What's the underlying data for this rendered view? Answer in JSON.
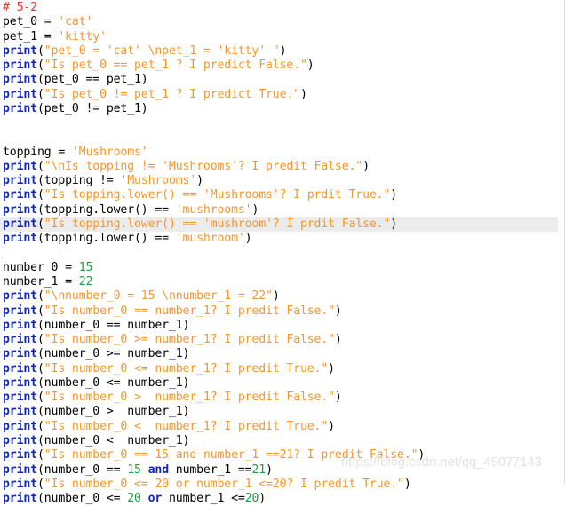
{
  "editor": {
    "language": "python",
    "background_color": "#ffffff",
    "right_border_color": "#cfe8cf",
    "current_line_highlight_color": "#ececec",
    "current_line_index": 15,
    "colors": {
      "plain": "#000000",
      "comment": "#e8372c",
      "string": "#f5972b",
      "keyword": "#1126b5",
      "number": "#1b9d3e"
    }
  },
  "watermark": {
    "text": "https://blog.csdn.net/qq_45077143"
  },
  "lines": [
    {
      "n": 1,
      "tokens": [
        {
          "t": "# 5-2",
          "c": "comment"
        }
      ]
    },
    {
      "n": 2,
      "tokens": [
        {
          "t": "pet_0 = ",
          "c": "plain"
        },
        {
          "t": "'cat'",
          "c": "string"
        }
      ]
    },
    {
      "n": 3,
      "tokens": [
        {
          "t": "pet_1 = ",
          "c": "plain"
        },
        {
          "t": "'kitty'",
          "c": "string"
        }
      ]
    },
    {
      "n": 4,
      "tokens": [
        {
          "t": "print",
          "c": "keyword"
        },
        {
          "t": "(",
          "c": "plain"
        },
        {
          "t": "\"pet_0 = 'cat' \\npet_1 = 'kitty' \"",
          "c": "string"
        },
        {
          "t": ")",
          "c": "plain"
        }
      ]
    },
    {
      "n": 5,
      "tokens": [
        {
          "t": "print",
          "c": "keyword"
        },
        {
          "t": "(",
          "c": "plain"
        },
        {
          "t": "\"Is pet_0 == pet_1 ? I predict False.\"",
          "c": "string"
        },
        {
          "t": ")",
          "c": "plain"
        }
      ]
    },
    {
      "n": 6,
      "tokens": [
        {
          "t": "print",
          "c": "keyword"
        },
        {
          "t": "(pet_0 == pet_1)",
          "c": "plain"
        }
      ]
    },
    {
      "n": 7,
      "tokens": [
        {
          "t": "print",
          "c": "keyword"
        },
        {
          "t": "(",
          "c": "plain"
        },
        {
          "t": "\"Is pet_0 != pet_1 ? I predict True.\"",
          "c": "string"
        },
        {
          "t": ")",
          "c": "plain"
        }
      ]
    },
    {
      "n": 8,
      "tokens": [
        {
          "t": "print",
          "c": "keyword"
        },
        {
          "t": "(pet_0 != pet_1)",
          "c": "plain"
        }
      ]
    },
    {
      "n": 9,
      "tokens": []
    },
    {
      "n": 10,
      "tokens": []
    },
    {
      "n": 11,
      "tokens": [
        {
          "t": "topping = ",
          "c": "plain"
        },
        {
          "t": "'Mushrooms'",
          "c": "string"
        }
      ]
    },
    {
      "n": 12,
      "tokens": [
        {
          "t": "print",
          "c": "keyword"
        },
        {
          "t": "(",
          "c": "plain"
        },
        {
          "t": "\"\\nIs topping != 'Mushrooms'? I predit False.\"",
          "c": "string"
        },
        {
          "t": ")",
          "c": "plain"
        }
      ]
    },
    {
      "n": 13,
      "tokens": [
        {
          "t": "print",
          "c": "keyword"
        },
        {
          "t": "(topping != ",
          "c": "plain"
        },
        {
          "t": "'Mushrooms'",
          "c": "string"
        },
        {
          "t": ")",
          "c": "plain"
        }
      ]
    },
    {
      "n": 14,
      "tokens": [
        {
          "t": "print",
          "c": "keyword"
        },
        {
          "t": "(",
          "c": "plain"
        },
        {
          "t": "\"Is topping.lower() == 'Mushrooms'? I prdit True.\"",
          "c": "string"
        },
        {
          "t": ")",
          "c": "plain"
        }
      ]
    },
    {
      "n": 15,
      "tokens": [
        {
          "t": "print",
          "c": "keyword"
        },
        {
          "t": "(topping.lower() == ",
          "c": "plain"
        },
        {
          "t": "'mushrooms'",
          "c": "string"
        },
        {
          "t": ")",
          "c": "plain"
        }
      ]
    },
    {
      "n": 16,
      "tokens": [
        {
          "t": "print",
          "c": "keyword"
        },
        {
          "t": "(",
          "c": "plain"
        },
        {
          "t": "\"Is topping.lower() == 'mushroom'? I prdit False.\"",
          "c": "string"
        },
        {
          "t": ")",
          "c": "plain"
        }
      ]
    },
    {
      "n": 17,
      "tokens": [
        {
          "t": "print",
          "c": "keyword"
        },
        {
          "t": "(topping.lower() == ",
          "c": "plain"
        },
        {
          "t": "'mushroom'",
          "c": "string"
        },
        {
          "t": ")",
          "c": "plain"
        }
      ]
    },
    {
      "n": 18,
      "tokens": [],
      "caret": true
    },
    {
      "n": 19,
      "tokens": [
        {
          "t": "number_0 = ",
          "c": "plain"
        },
        {
          "t": "15",
          "c": "number"
        }
      ]
    },
    {
      "n": 20,
      "tokens": [
        {
          "t": "number_1 = ",
          "c": "plain"
        },
        {
          "t": "22",
          "c": "number"
        }
      ]
    },
    {
      "n": 21,
      "tokens": [
        {
          "t": "print",
          "c": "keyword"
        },
        {
          "t": "(",
          "c": "plain"
        },
        {
          "t": "\"\\nnumber_0 = 15 \\nnumber_1 = 22\"",
          "c": "string"
        },
        {
          "t": ")",
          "c": "plain"
        }
      ]
    },
    {
      "n": 22,
      "tokens": [
        {
          "t": "print",
          "c": "keyword"
        },
        {
          "t": "(",
          "c": "plain"
        },
        {
          "t": "\"Is number_0 == number_1? I predit False.\"",
          "c": "string"
        },
        {
          "t": ")",
          "c": "plain"
        }
      ]
    },
    {
      "n": 23,
      "tokens": [
        {
          "t": "print",
          "c": "keyword"
        },
        {
          "t": "(number_0 == number_1)",
          "c": "plain"
        }
      ]
    },
    {
      "n": 24,
      "tokens": [
        {
          "t": "print",
          "c": "keyword"
        },
        {
          "t": "(",
          "c": "plain"
        },
        {
          "t": "\"Is number_0 >= number_1? I predit False.\"",
          "c": "string"
        },
        {
          "t": ")",
          "c": "plain"
        }
      ]
    },
    {
      "n": 25,
      "tokens": [
        {
          "t": "print",
          "c": "keyword"
        },
        {
          "t": "(number_0 >= number_1)",
          "c": "plain"
        }
      ]
    },
    {
      "n": 26,
      "tokens": [
        {
          "t": "print",
          "c": "keyword"
        },
        {
          "t": "(",
          "c": "plain"
        },
        {
          "t": "\"Is number_0 <= number_1? I predit True.\"",
          "c": "string"
        },
        {
          "t": ")",
          "c": "plain"
        }
      ]
    },
    {
      "n": 27,
      "tokens": [
        {
          "t": "print",
          "c": "keyword"
        },
        {
          "t": "(number_0 <= number_1)",
          "c": "plain"
        }
      ]
    },
    {
      "n": 28,
      "tokens": [
        {
          "t": "print",
          "c": "keyword"
        },
        {
          "t": "(",
          "c": "plain"
        },
        {
          "t": "\"Is number_0 >  number_1? I predit False.\"",
          "c": "string"
        },
        {
          "t": ")",
          "c": "plain"
        }
      ]
    },
    {
      "n": 29,
      "tokens": [
        {
          "t": "print",
          "c": "keyword"
        },
        {
          "t": "(number_0 >  number_1)",
          "c": "plain"
        }
      ]
    },
    {
      "n": 30,
      "tokens": [
        {
          "t": "print",
          "c": "keyword"
        },
        {
          "t": "(",
          "c": "plain"
        },
        {
          "t": "\"Is number_0 <  number_1? I predit True.\"",
          "c": "string"
        },
        {
          "t": ")",
          "c": "plain"
        }
      ]
    },
    {
      "n": 31,
      "tokens": [
        {
          "t": "print",
          "c": "keyword"
        },
        {
          "t": "(number_0 <  number_1)",
          "c": "plain"
        }
      ]
    },
    {
      "n": 32,
      "tokens": [
        {
          "t": "print",
          "c": "keyword"
        },
        {
          "t": "(",
          "c": "plain"
        },
        {
          "t": "\"Is number_0 == 15 and number_1 ==21? I predit False.\"",
          "c": "string"
        },
        {
          "t": ")",
          "c": "plain"
        }
      ]
    },
    {
      "n": 33,
      "tokens": [
        {
          "t": "print",
          "c": "keyword"
        },
        {
          "t": "(number_0 == ",
          "c": "plain"
        },
        {
          "t": "15",
          "c": "number"
        },
        {
          "t": " ",
          "c": "plain"
        },
        {
          "t": "and",
          "c": "keyword"
        },
        {
          "t": " number_1 ==",
          "c": "plain"
        },
        {
          "t": "21",
          "c": "number"
        },
        {
          "t": ")",
          "c": "plain"
        }
      ]
    },
    {
      "n": 34,
      "tokens": [
        {
          "t": "print",
          "c": "keyword"
        },
        {
          "t": "(",
          "c": "plain"
        },
        {
          "t": "\"Is number_0 <= 20 or number_1 <=20? I predit True.\"",
          "c": "string"
        },
        {
          "t": ")",
          "c": "plain"
        }
      ]
    },
    {
      "n": 35,
      "tokens": [
        {
          "t": "print",
          "c": "keyword"
        },
        {
          "t": "(number_0 <= ",
          "c": "plain"
        },
        {
          "t": "20",
          "c": "number"
        },
        {
          "t": " ",
          "c": "plain"
        },
        {
          "t": "or",
          "c": "keyword"
        },
        {
          "t": " number_1 <=",
          "c": "plain"
        },
        {
          "t": "20",
          "c": "number"
        },
        {
          "t": ")",
          "c": "plain"
        }
      ]
    }
  ]
}
